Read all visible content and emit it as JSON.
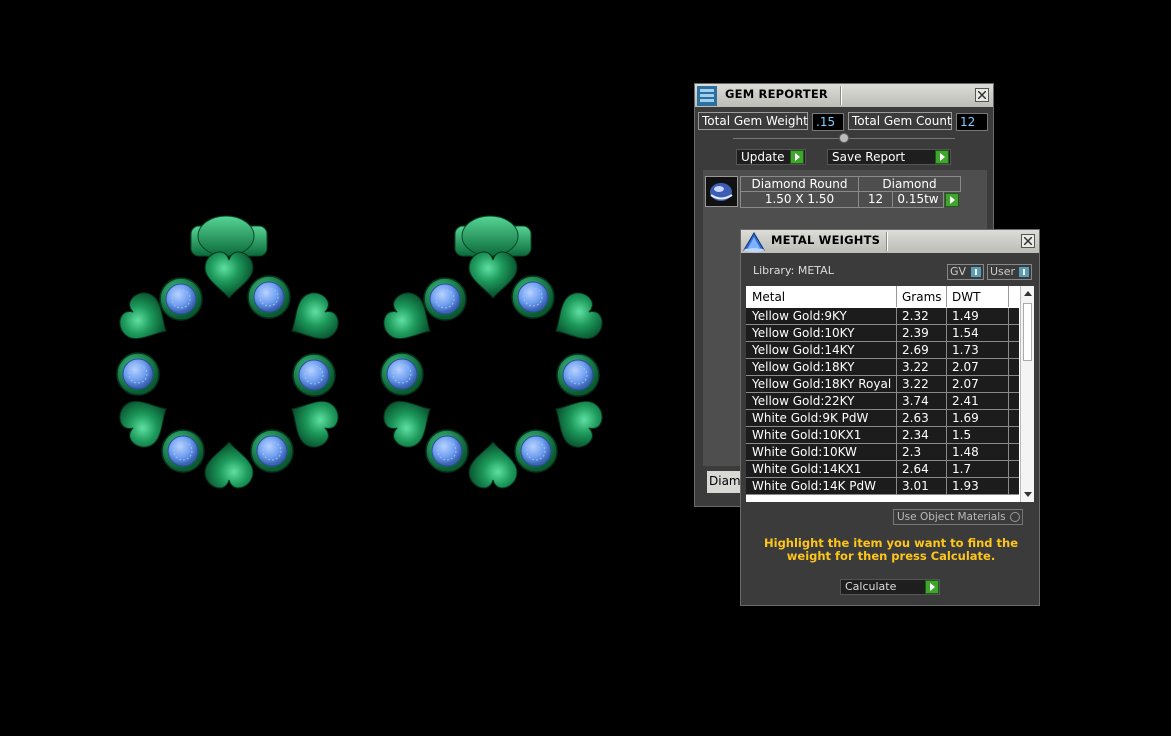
{
  "gem_reporter": {
    "title": "GEM REPORTER",
    "total_weight_label": "Total Gem Weight",
    "total_weight_value": ".15",
    "total_count_label": "Total Gem Count",
    "total_count_value": "12",
    "update_label": "Update",
    "save_report_label": "Save Report",
    "gem_row": {
      "shape": "Diamond Round",
      "material": "Diamond",
      "size": "1.50 X 1.50",
      "count": "12",
      "weight": "0.15tw"
    },
    "bottom_tab": "Diamond"
  },
  "metal_weights": {
    "title": "METAL WEIGHTS",
    "library_label": "Library: METAL",
    "toggle_gv": "GV",
    "toggle_user": "User",
    "columns": [
      "Metal",
      "Grams",
      "DWT"
    ],
    "rows": [
      {
        "metal": "Yellow Gold:9KY",
        "grams": "2.32",
        "dwt": "1.49"
      },
      {
        "metal": "Yellow Gold:10KY",
        "grams": "2.39",
        "dwt": "1.54"
      },
      {
        "metal": "Yellow Gold:14KY",
        "grams": "2.69",
        "dwt": "1.73"
      },
      {
        "metal": "Yellow Gold:18KY",
        "grams": "3.22",
        "dwt": "2.07"
      },
      {
        "metal": "Yellow Gold:18KY Royal",
        "grams": "3.22",
        "dwt": "2.07"
      },
      {
        "metal": "Yellow Gold:22KY",
        "grams": "3.74",
        "dwt": "2.41"
      },
      {
        "metal": "White Gold:9K PdW",
        "grams": "2.63",
        "dwt": "1.69"
      },
      {
        "metal": "White Gold:10KX1",
        "grams": "2.34",
        "dwt": "1.5"
      },
      {
        "metal": "White Gold:10KW",
        "grams": "2.3",
        "dwt": "1.48"
      },
      {
        "metal": "White Gold:14KX1",
        "grams": "2.64",
        "dwt": "1.7"
      },
      {
        "metal": "White Gold:14K PdW",
        "grams": "3.01",
        "dwt": "1.93"
      }
    ],
    "use_object_materials_label": "Use Object Materials",
    "hint": "Highlight the item you want to find the weight for then press Calculate.",
    "calculate_label": "Calculate"
  },
  "colors": {
    "metal_green": "#1f9a5e",
    "gem_blue": "#6f9ff0",
    "hint_yellow": "#ffc61a",
    "value_cyan": "#7fd0ff"
  }
}
